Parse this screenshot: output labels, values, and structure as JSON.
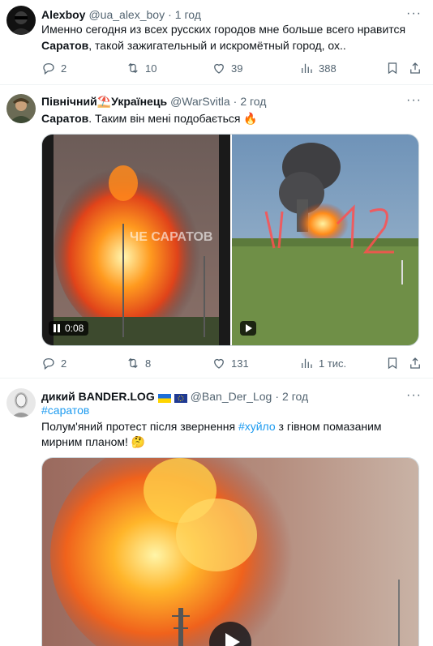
{
  "tweets": [
    {
      "name": "Alexboy",
      "handle": "@ua_alex_boy",
      "time": "1 год",
      "text_1": "Именно сегодня из всех русских городов мне больше всего нравится",
      "text_bold": "Саратов",
      "text_2": ", такой зажигательный и искромётный город, ох..",
      "replies": "2",
      "retweets": "10",
      "likes": "39",
      "views": "388"
    },
    {
      "name": "Північний",
      "name_2": "Українець",
      "handle": "@WarSvitla",
      "time": "2 год",
      "text_bold": "Саратов",
      "text_2": ". Таким він мені подобається 🔥",
      "video_time": "0:08",
      "watermark": "ЧЕ САРАТОВ",
      "replies": "2",
      "retweets": "8",
      "likes": "131",
      "views": "1 тис."
    },
    {
      "name": "дикий BANDER.LOG",
      "handle": "@Ban_Der_Log",
      "time": "2 год",
      "hashtag": "#саратов",
      "text_1": "Полум'яний протест після звернення ",
      "hashtag_2": "#хуйло",
      "text_2": " з гівном помазаним",
      "text_3": "мирним планом! 🤔"
    }
  ],
  "colors": {
    "link": "#1d9bf0",
    "secondary": "#536471",
    "border": "#eff3f4"
  },
  "icons": [
    "reply-icon",
    "retweet-icon",
    "like-icon",
    "views-icon",
    "bookmark-icon",
    "share-icon",
    "more-icon",
    "play-icon",
    "pause-icon"
  ]
}
